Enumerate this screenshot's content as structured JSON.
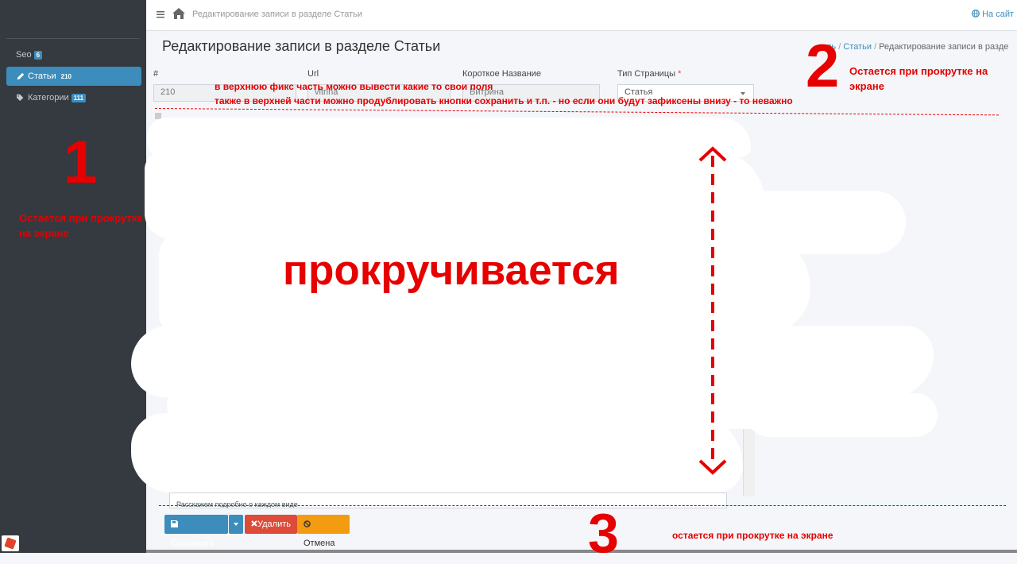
{
  "sidebar": {
    "items": [
      {
        "label": "Seo",
        "badge": "6"
      },
      {
        "label": "Статьи",
        "badge": "210"
      },
      {
        "label": "Категории",
        "badge": "111"
      }
    ]
  },
  "topbar": {
    "breadcrumb": "Редактирование записи в разделе Статьи",
    "site_link": "На сайт"
  },
  "page": {
    "title": "Редактирование записи в разделе Статьи",
    "breadcrumbs": {
      "home": "ль",
      "section": "Статьи",
      "current": "Редактирование записи в разде"
    }
  },
  "form": {
    "fields": [
      {
        "label": "#",
        "value": "210"
      },
      {
        "label": "Url",
        "value": "vitrina"
      },
      {
        "label": "Короткое Название",
        "value": "Витрина"
      },
      {
        "label": "Тип Страницы",
        "required": "*",
        "value": "Статья"
      }
    ],
    "textarea_text": "Расскажем подробно о каждом виде",
    "buttons": {
      "save": "Сохранить",
      "delete": "Удалить",
      "cancel": "Отмена"
    }
  },
  "annotations": {
    "num1": "1",
    "num2": "2",
    "num3": "3",
    "note1": "Остается при прокрутке на экране",
    "note2": "Остается при прокрутке на экране",
    "note3": "остается при прокрутке на экране",
    "top_line1": "в верхнюю фикс часть можно вывести какие то свои поля",
    "top_line2": "также в верхней части можно продублировать кнопки сохранить и т.п. - но если они будут зафиксены внизу - то неважно",
    "scroll": "прокручивается"
  },
  "colors": {
    "annotation": "#e60000",
    "sidebar_bg": "#343a40",
    "accent": "#3c8dbc",
    "danger": "#dd4b39",
    "warning": "#f39c12"
  }
}
